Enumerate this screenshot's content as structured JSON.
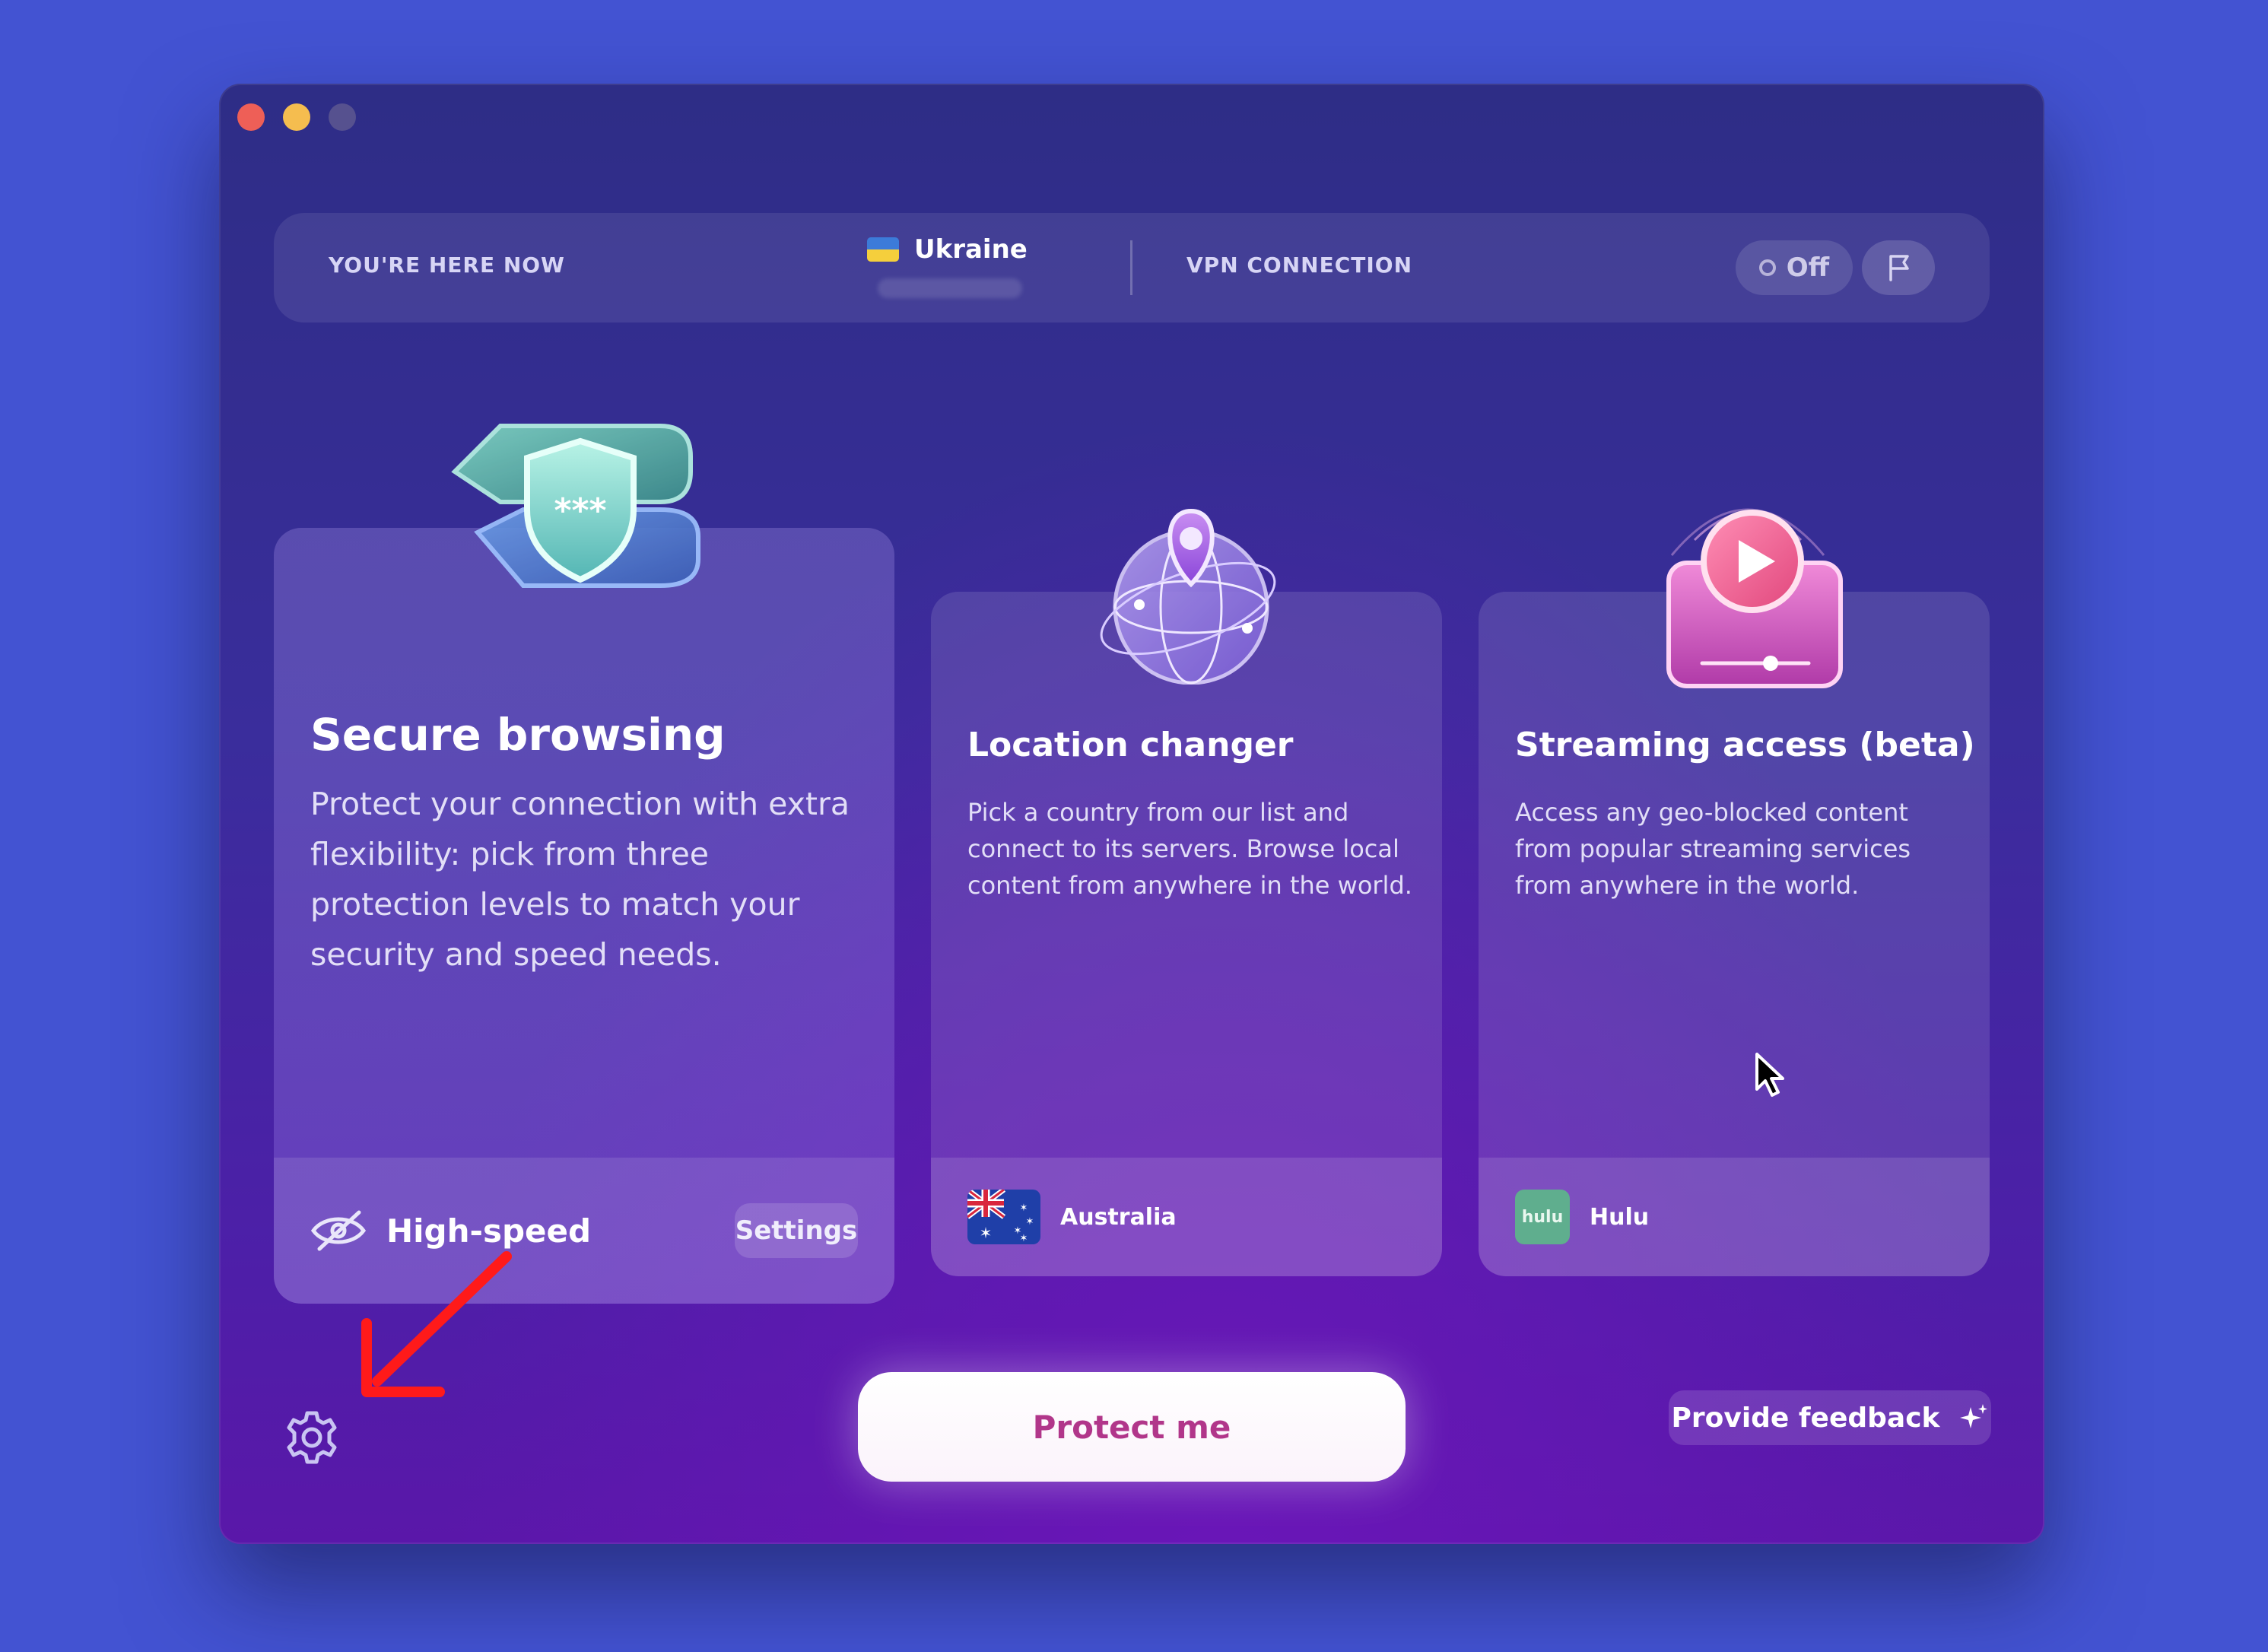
{
  "status_bar": {
    "location_label": "YOU'RE HERE NOW",
    "country": "Ukraine",
    "vpn_label": "VPN CONNECTION",
    "vpn_state": "Off"
  },
  "cards": {
    "secure": {
      "title": "Secure browsing",
      "description": "Protect your connection with extra flexibility: pick from three protection levels to match your security and speed needs.",
      "mode": "High-speed",
      "settings_label": "Settings"
    },
    "location": {
      "title": "Location changer",
      "description": "Pick a country from our list and connect to its servers. Browse local content from anywhere in the world.",
      "country": "Australia"
    },
    "streaming": {
      "title": "Streaming access (beta)",
      "description": "Access any geo-blocked content from popular streaming services from anywhere in the world.",
      "service": "Hulu",
      "service_logo_text": "hulu"
    }
  },
  "actions": {
    "protect": "Protect me",
    "feedback": "Provide feedback"
  },
  "colors": {
    "background": "#4353d2",
    "accent_text": "#b1368a",
    "annotation_arrow": "#ff1a1a"
  }
}
